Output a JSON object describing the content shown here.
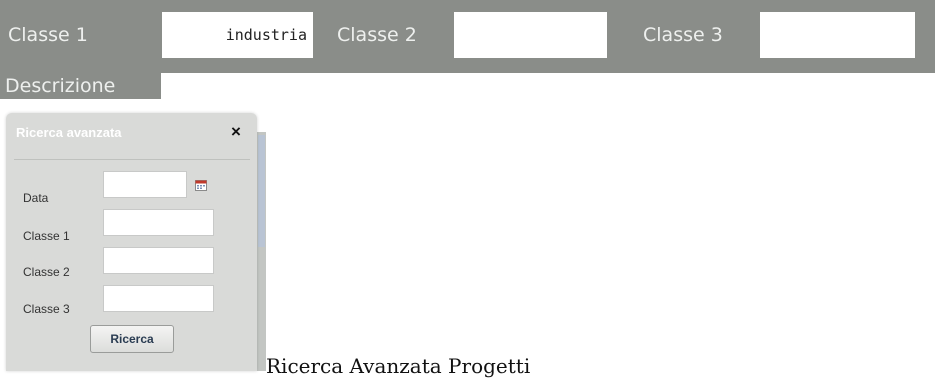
{
  "filter_bar": {
    "classe1_label": "Classe 1",
    "classe1_value": "industria",
    "classe2_label": "Classe 2",
    "classe2_value": "",
    "classe3_label": "Classe 3",
    "classe3_value": "",
    "descrizione_label": "Descrizione",
    "descrizione_value": ""
  },
  "advanced_search": {
    "title": "Ricerca avanzata",
    "close_symbol": "×",
    "fields": {
      "data_label": "Data",
      "data_value": "",
      "classe1_label": "Classe 1",
      "classe1_value": "",
      "classe2_label": "Classe 2",
      "classe2_value": "",
      "classe3_label": "Classe 3",
      "classe3_value": ""
    },
    "search_button": "Ricerca",
    "calendar_icon": "calendar-icon"
  },
  "caption": "Ricerca Avanzata Progetti",
  "colors": {
    "bar": "#8a8d89",
    "panel": "#d9dad8",
    "button_text": "#2a3c52"
  }
}
